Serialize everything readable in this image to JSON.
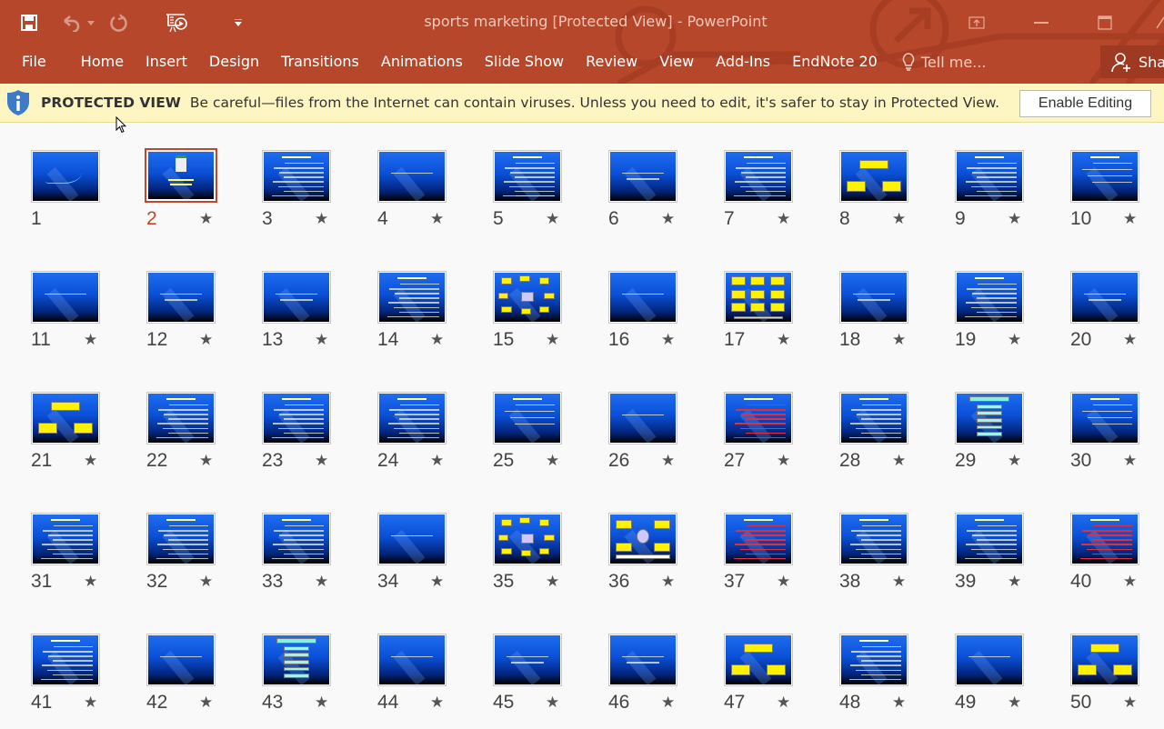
{
  "window": {
    "title": "sports marketing [Protected View] - PowerPoint",
    "accent_color": "#b7472a"
  },
  "quick_access": {
    "save_icon": "save-icon",
    "undo_icon": "undo-icon",
    "redo_icon": "redo-icon",
    "slideshow_icon": "start-slideshow-icon",
    "customize_icon": "customize-qat-icon"
  },
  "ribbon": {
    "tabs": [
      {
        "label": "File"
      },
      {
        "label": "Home"
      },
      {
        "label": "Insert"
      },
      {
        "label": "Design"
      },
      {
        "label": "Transitions"
      },
      {
        "label": "Animations"
      },
      {
        "label": "Slide Show"
      },
      {
        "label": "Review"
      },
      {
        "label": "View"
      },
      {
        "label": "Add-Ins"
      },
      {
        "label": "EndNote 20"
      }
    ],
    "tell_me": "Tell me...",
    "share": "Share"
  },
  "protected_view": {
    "title": "PROTECTED VIEW",
    "message": "Be careful—files from the Internet can contain viruses. Unless you need to edit, it's safer to stay in Protected View.",
    "enable_button": "Enable Editing",
    "bar_color": "#fdf6c3"
  },
  "slide_sorter": {
    "selected_slide": 2,
    "slides": [
      {
        "n": "1",
        "star": false,
        "kind": "calligraphy"
      },
      {
        "n": "2",
        "star": true,
        "kind": "logo"
      },
      {
        "n": "3",
        "star": true,
        "kind": "text"
      },
      {
        "n": "4",
        "star": true,
        "kind": "title"
      },
      {
        "n": "5",
        "star": true,
        "kind": "text-yellow"
      },
      {
        "n": "6",
        "star": true,
        "kind": "title2"
      },
      {
        "n": "7",
        "star": true,
        "kind": "text"
      },
      {
        "n": "8",
        "star": true,
        "kind": "diagram"
      },
      {
        "n": "9",
        "star": true,
        "kind": "text"
      },
      {
        "n": "10",
        "star": true,
        "kind": "text-sparse"
      },
      {
        "n": "11",
        "star": true,
        "kind": "title"
      },
      {
        "n": "12",
        "star": true,
        "kind": "title2"
      },
      {
        "n": "13",
        "star": true,
        "kind": "title2"
      },
      {
        "n": "14",
        "star": true,
        "kind": "text"
      },
      {
        "n": "15",
        "star": true,
        "kind": "hub"
      },
      {
        "n": "16",
        "star": true,
        "kind": "title"
      },
      {
        "n": "17",
        "star": true,
        "kind": "flow"
      },
      {
        "n": "18",
        "star": true,
        "kind": "title2"
      },
      {
        "n": "19",
        "star": true,
        "kind": "text"
      },
      {
        "n": "20",
        "star": true,
        "kind": "title2"
      },
      {
        "n": "21",
        "star": true,
        "kind": "diagram"
      },
      {
        "n": "22",
        "star": true,
        "kind": "text"
      },
      {
        "n": "23",
        "star": true,
        "kind": "text"
      },
      {
        "n": "24",
        "star": true,
        "kind": "text"
      },
      {
        "n": "25",
        "star": true,
        "kind": "text-sparse"
      },
      {
        "n": "26",
        "star": true,
        "kind": "title"
      },
      {
        "n": "27",
        "star": true,
        "kind": "text-red"
      },
      {
        "n": "28",
        "star": true,
        "kind": "text"
      },
      {
        "n": "29",
        "star": true,
        "kind": "stack"
      },
      {
        "n": "30",
        "star": true,
        "kind": "text-sparse"
      },
      {
        "n": "31",
        "star": true,
        "kind": "text"
      },
      {
        "n": "32",
        "star": true,
        "kind": "text"
      },
      {
        "n": "33",
        "star": true,
        "kind": "text"
      },
      {
        "n": "34",
        "star": true,
        "kind": "title"
      },
      {
        "n": "35",
        "star": true,
        "kind": "hub"
      },
      {
        "n": "36",
        "star": true,
        "kind": "cross"
      },
      {
        "n": "37",
        "star": true,
        "kind": "text-red"
      },
      {
        "n": "38",
        "star": true,
        "kind": "text"
      },
      {
        "n": "39",
        "star": true,
        "kind": "text"
      },
      {
        "n": "40",
        "star": true,
        "kind": "text-red"
      },
      {
        "n": "41",
        "star": true,
        "kind": "text"
      },
      {
        "n": "42",
        "star": true,
        "kind": "title"
      },
      {
        "n": "43",
        "star": true,
        "kind": "stack"
      },
      {
        "n": "44",
        "star": true,
        "kind": "title"
      },
      {
        "n": "45",
        "star": true,
        "kind": "title2"
      },
      {
        "n": "46",
        "star": true,
        "kind": "title2"
      },
      {
        "n": "47",
        "star": true,
        "kind": "diagram"
      },
      {
        "n": "48",
        "star": true,
        "kind": "text"
      },
      {
        "n": "49",
        "star": true,
        "kind": "title"
      },
      {
        "n": "50",
        "star": true,
        "kind": "diagram"
      }
    ]
  }
}
